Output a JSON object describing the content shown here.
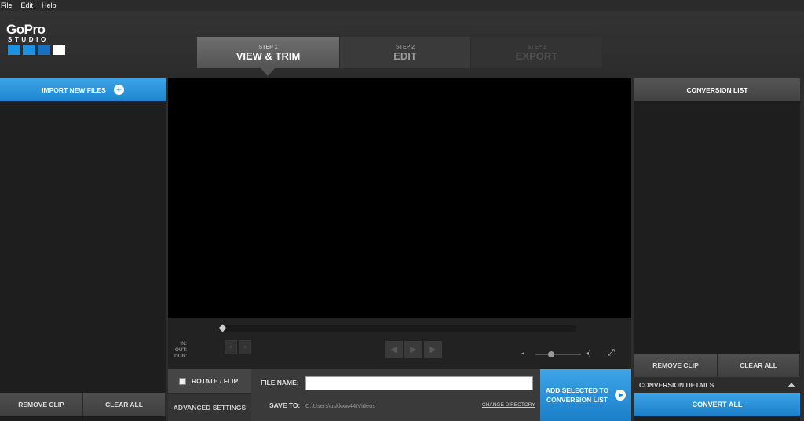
{
  "menu": {
    "file": "File",
    "edit": "Edit",
    "help": "Help"
  },
  "logo": {
    "brand": "GoPro",
    "sub": "STUDIO",
    "squares": [
      "#1e90e0",
      "#1e90e0",
      "#1a6fc0",
      "#ffffff"
    ]
  },
  "steps": [
    {
      "num": "STEP 1",
      "title": "VIEW & TRIM",
      "state": "active"
    },
    {
      "num": "STEP 2",
      "title": "EDIT",
      "state": "inactive"
    },
    {
      "num": "STEP 3",
      "title": "EXPORT",
      "state": "disabled"
    }
  ],
  "left_panel": {
    "import_label": "IMPORT NEW FILES",
    "import_icon": "plus-circle-icon",
    "remove_clip": "REMOVE CLIP",
    "clear_all": "CLEAR ALL"
  },
  "player": {
    "in_label": "IN:",
    "out_label": "OUT:",
    "dur_label": "DUR:",
    "prev_icon": "chevron-left-icon",
    "next_icon": "chevron-right-icon",
    "step_back_icon": "step-back-icon",
    "play_icon": "play-icon",
    "step_forward_icon": "step-forward-icon",
    "volume_low_icon": "volume-low-icon",
    "volume_high_icon": "volume-high-icon",
    "fullscreen_icon": "fullscreen-icon",
    "volume_level": 0.35,
    "scrub_position": 0
  },
  "export_bar": {
    "rotate_flip": "ROTATE / FLIP",
    "advanced_settings": "ADVANCED SETTINGS",
    "file_name_label": "FILE NAME:",
    "file_name_value": "",
    "save_to_label": "SAVE TO:",
    "save_path": "C:\\Users\\uskkxw44\\Videos",
    "change_directory": "CHANGE DIRECTORY",
    "add_selected_line1": "ADD SELECTED TO",
    "add_selected_line2": "CONVERSION LIST"
  },
  "right_panel": {
    "title": "CONVERSION LIST",
    "remove_clip": "REMOVE CLIP",
    "clear_all": "CLEAR ALL",
    "conversion_details": "CONVERSION DETAILS",
    "convert_all": "CONVERT ALL"
  },
  "colors": {
    "accent_blue": "#2596e0",
    "background": "#2d2d2d",
    "panel": "#1e1e1e"
  }
}
